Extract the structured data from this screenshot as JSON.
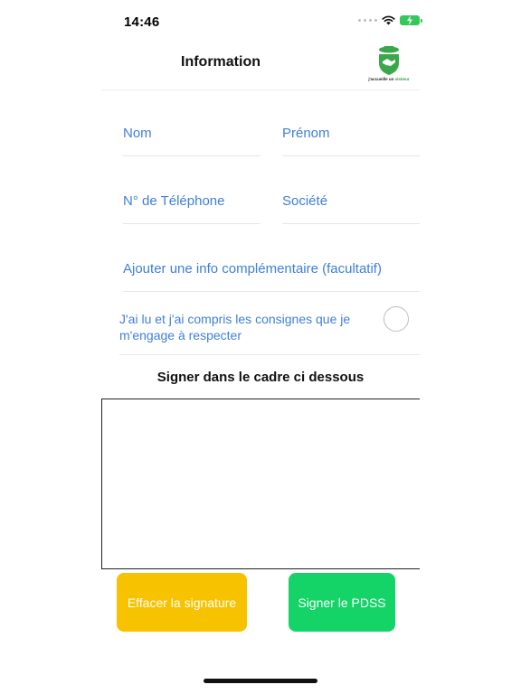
{
  "status_bar": {
    "time": "14:46"
  },
  "nav": {
    "title": "Information",
    "logo": {
      "icon": "shield-handshake-logo",
      "text_prefix": "j'accueille un",
      "text_accent": "visiteur"
    }
  },
  "form": {
    "nom_placeholder": "Nom",
    "prenom_placeholder": "Prénom",
    "telephone_placeholder": "N° de Téléphone",
    "societe_placeholder": "Société",
    "info_placeholder": "Ajouter une info complémentaire (facultatif)",
    "nom_value": "",
    "prenom_value": "",
    "telephone_value": "",
    "societe_value": "",
    "info_value": ""
  },
  "consent": {
    "text": "J'ai lu et j'ai compris les consignes que je m'engage à respecter",
    "checked": false
  },
  "signature": {
    "heading": "Signer dans le cadre ci dessous"
  },
  "buttons": {
    "clear_label": "Effacer la signature",
    "sign_label": "Signer le PDSS"
  },
  "colors": {
    "link_blue": "#3f7fd9",
    "clear_yellow": "#f7c200",
    "sign_green": "#15d467",
    "battery_green": "#34c759"
  }
}
